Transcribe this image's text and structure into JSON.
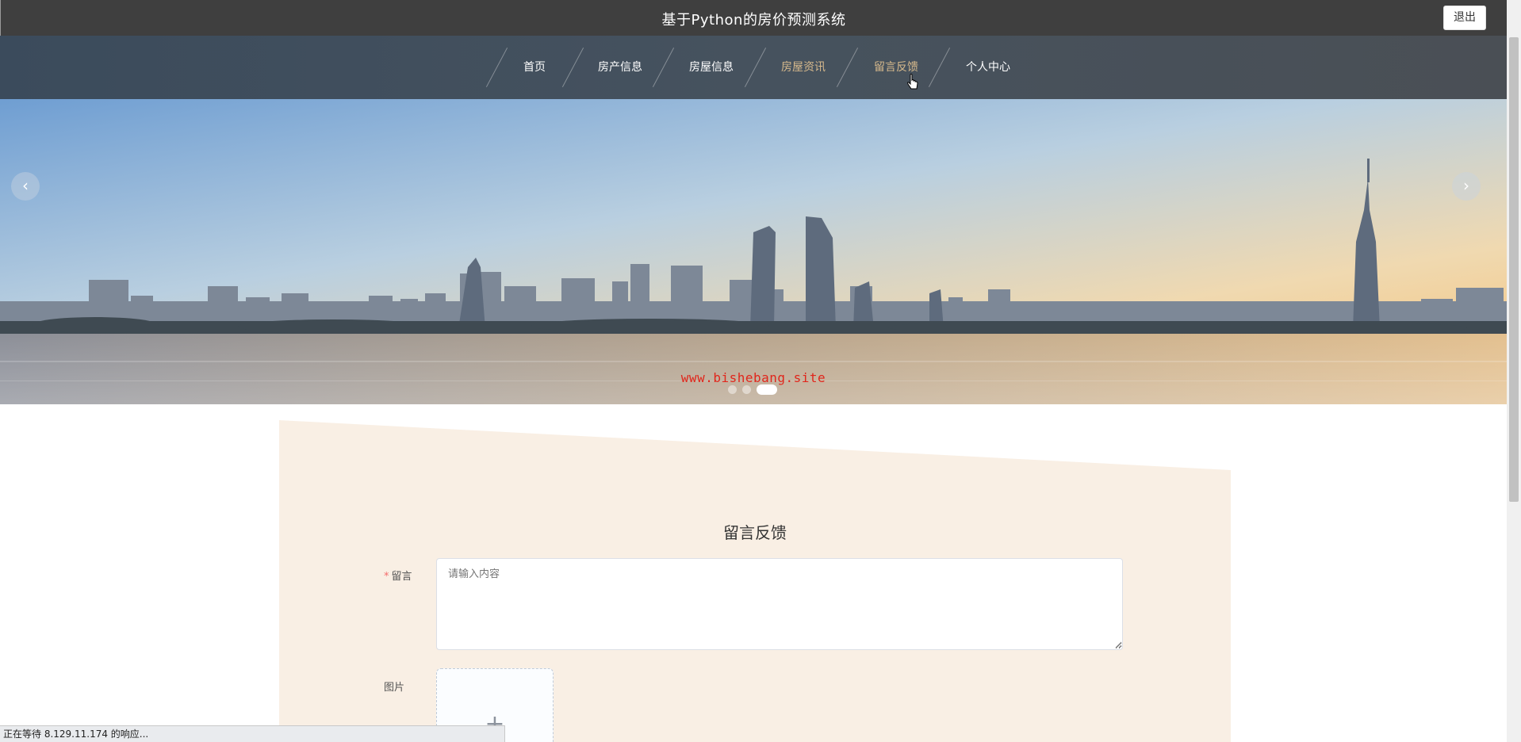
{
  "header": {
    "title": "基于Python的房价预测系统",
    "logout_label": "退出"
  },
  "nav": {
    "items": [
      {
        "label": "首页"
      },
      {
        "label": "房产信息"
      },
      {
        "label": "房屋信息"
      },
      {
        "label": "房屋资讯"
      },
      {
        "label": "留言反馈"
      },
      {
        "label": "个人中心"
      }
    ],
    "highlighted": [
      "房屋资讯",
      "留言反馈"
    ]
  },
  "banner": {
    "watermark": "www.bishebang.site",
    "prev_icon": "chevron-left-icon",
    "next_icon": "chevron-right-icon",
    "slide_count": 3,
    "active_slide": 3
  },
  "form": {
    "title": "留言反馈",
    "message_label": "留言",
    "message_required_mark": "*",
    "message_placeholder": "请输入内容",
    "image_label": "图片",
    "upload_icon": "plus-icon"
  },
  "status_bar": {
    "text": "正在等待 8.129.11.174 的响应..."
  },
  "colors": {
    "topbar": "#3f3f3f",
    "accent": "#d6b98c",
    "panel": "#f9efe4",
    "watermark": "#e0261b"
  }
}
